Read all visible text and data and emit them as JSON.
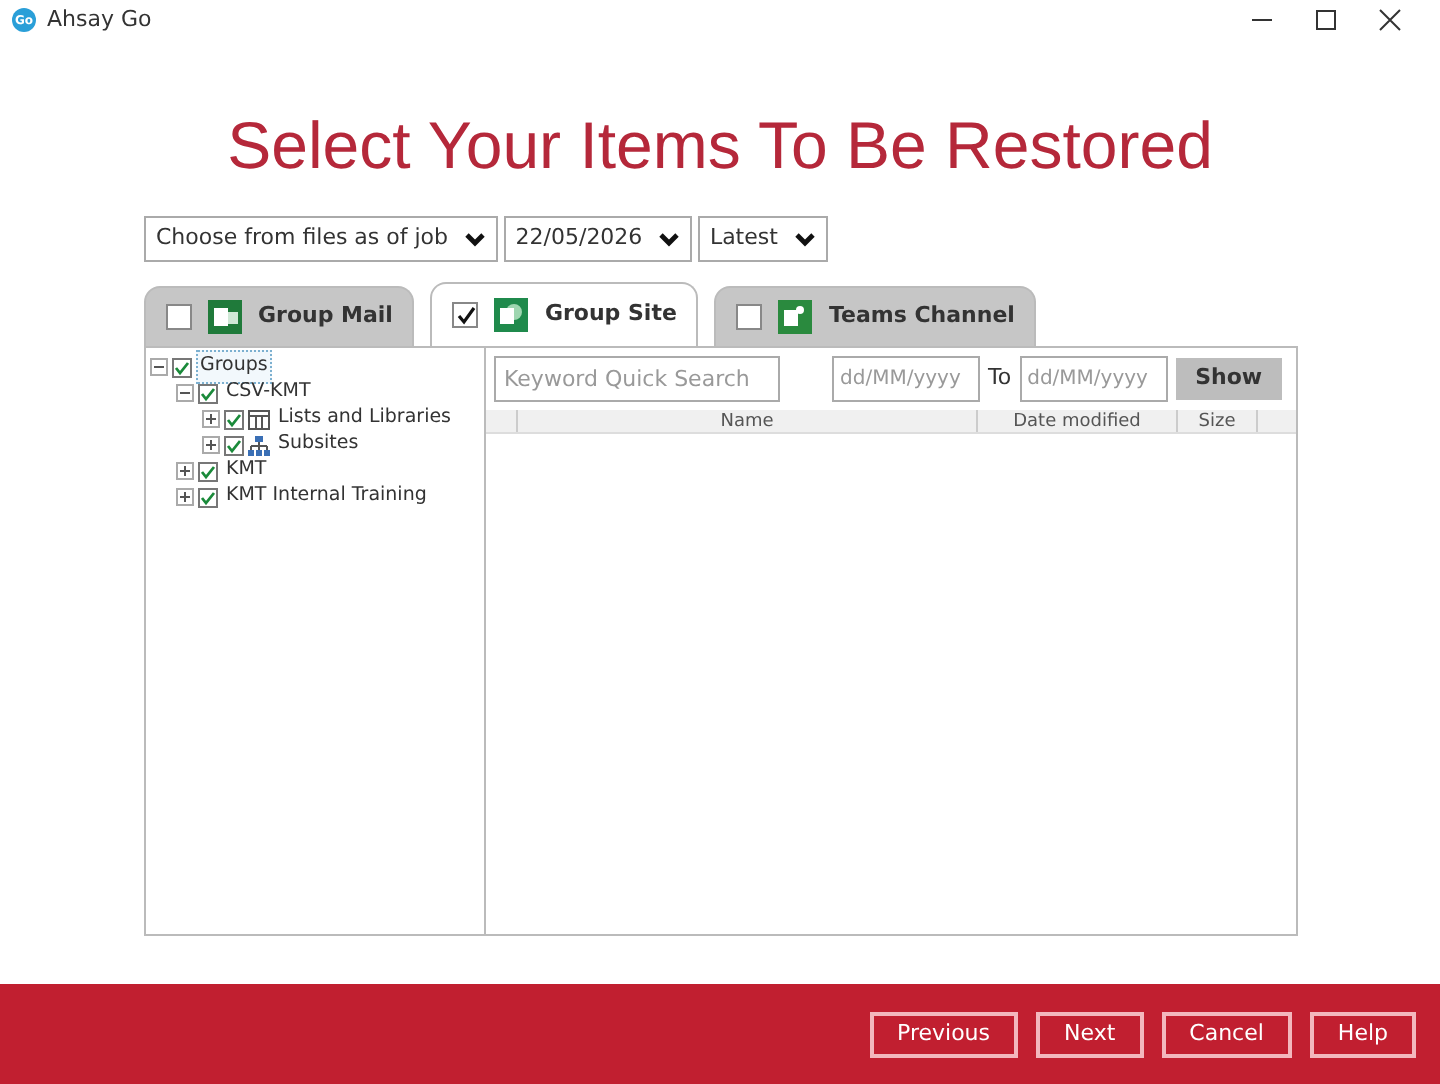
{
  "window": {
    "title": "Ahsay Go",
    "app_icon": "Go"
  },
  "heading": "Select Your Items To Be Restored",
  "selectors": [
    {
      "value": "Choose from files as of job"
    },
    {
      "value": "22/05/2026"
    },
    {
      "value": "Latest"
    }
  ],
  "tabs": [
    {
      "label": "Group Mail",
      "selected": false,
      "checked": false,
      "kind": "mail"
    },
    {
      "label": "Group Site",
      "selected": true,
      "checked": true,
      "kind": "site"
    },
    {
      "label": "Teams Channel",
      "selected": false,
      "checked": false,
      "kind": "teams"
    }
  ],
  "tree": [
    {
      "label": "Groups",
      "checked": true,
      "expanded": true,
      "selected": true,
      "children": [
        {
          "label": "CSV-KMT",
          "checked": true,
          "expanded": true,
          "selected": false,
          "children": [
            {
              "label": "Lists and Libraries",
              "kind": "library",
              "checked": true,
              "expanded": false,
              "selected": false
            },
            {
              "label": "Subsites",
              "kind": "subsites",
              "checked": true,
              "expanded": false,
              "selected": false
            }
          ]
        },
        {
          "label": "KMT",
          "checked": true,
          "expanded": false,
          "selected": false
        },
        {
          "label": "KMT Internal Training",
          "checked": true,
          "expanded": false,
          "selected": false
        }
      ]
    }
  ],
  "search": {
    "placeholder": "Keyword Quick Search"
  },
  "date_from": {
    "placeholder": "dd/MM/yyyy"
  },
  "to_label": "To",
  "date_to": {
    "placeholder": "dd/MM/yyyy"
  },
  "show_button": "Show",
  "table": {
    "columns": [
      "Name",
      "Date modified",
      "Size"
    ]
  },
  "buttons": [
    "Previous",
    "Next",
    "Cancel",
    "Help"
  ]
}
